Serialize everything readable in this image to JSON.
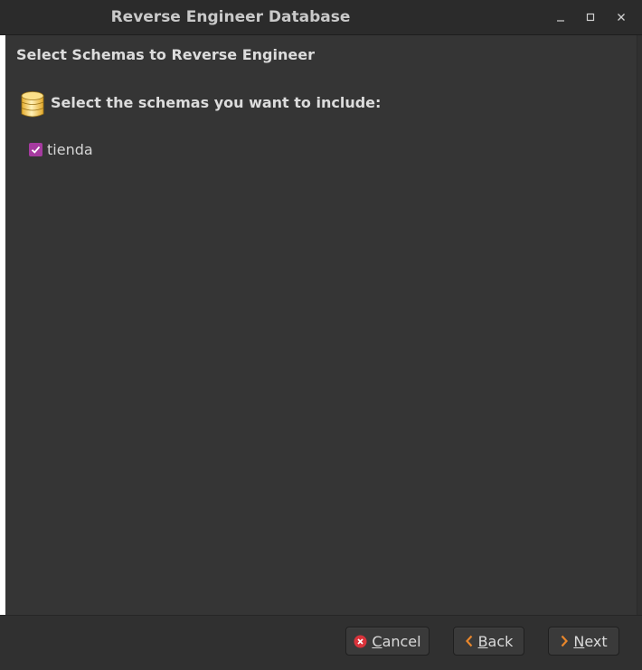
{
  "window": {
    "title": "Reverse Engineer Database"
  },
  "page": {
    "heading": "Select Schemas to Reverse Engineer",
    "instruction": "Select the schemas you want to include:"
  },
  "schemas": [
    {
      "name": "tienda",
      "checked": true
    }
  ],
  "buttons": {
    "cancel": {
      "mnemonic": "C",
      "rest": "ancel"
    },
    "back": {
      "mnemonic": "B",
      "rest": "ack"
    },
    "next": {
      "mnemonic": "N",
      "rest": "ext"
    }
  },
  "colors": {
    "checkbox": "#a63ba0",
    "cancel_icon": "#d9333b",
    "arrow_icon": "#e8862b",
    "db_icon": "#f2c64a"
  }
}
